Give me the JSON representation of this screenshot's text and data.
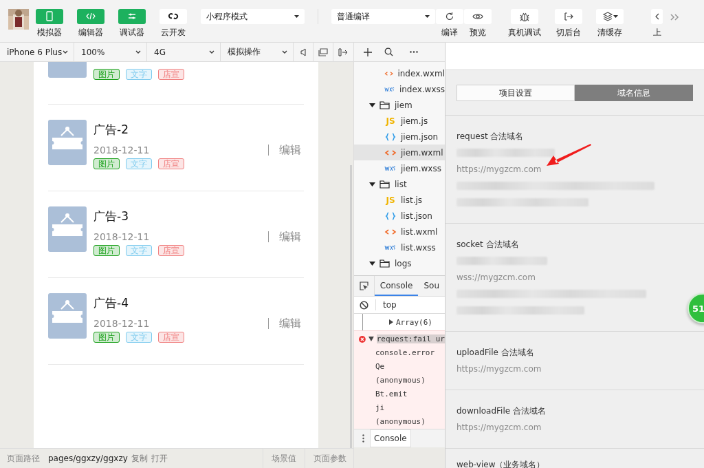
{
  "toolbar": {
    "view_toggles": [
      {
        "label": "模拟器",
        "on": true
      },
      {
        "label": "编辑器",
        "on": true
      },
      {
        "label": "调试器",
        "on": true
      },
      {
        "label": "云开发",
        "on": false
      }
    ],
    "mode_select": "小程序模式",
    "compile_select": "普通编译",
    "actions": [
      {
        "label": "编译"
      },
      {
        "label": "预览"
      },
      {
        "label": "真机调试"
      },
      {
        "label": "切后台"
      },
      {
        "label": "清缓存"
      },
      {
        "label": "上"
      }
    ]
  },
  "device_bar": {
    "device": "iPhone 6 Plus",
    "zoom": "100%",
    "network": "4G",
    "operation": "模拟操作"
  },
  "ad_list": [
    {
      "kind": "partial",
      "tags": [
        {
          "text": "图片",
          "color": "#1aa01a"
        },
        {
          "text": "文字",
          "color": "#7fcbee"
        },
        {
          "text": "店宣",
          "color": "#f07f7f"
        }
      ]
    },
    {
      "kind": "full",
      "title": "广告-2",
      "date": "2018-12-11",
      "edit": "编辑",
      "tags": [
        {
          "text": "图片",
          "color": "#1aa01a"
        },
        {
          "text": "文字",
          "color": "#7fcbee"
        },
        {
          "text": "店宣",
          "color": "#f07f7f"
        }
      ]
    },
    {
      "kind": "full",
      "title": "广告-3",
      "date": "2018-12-11",
      "edit": "编辑",
      "tags": [
        {
          "text": "图片",
          "color": "#1aa01a"
        },
        {
          "text": "文字",
          "color": "#7fcbee"
        },
        {
          "text": "店宣",
          "color": "#f07f7f"
        }
      ]
    },
    {
      "kind": "full",
      "title": "广告-4",
      "date": "2018-12-11",
      "edit": "编辑",
      "tags": [
        {
          "text": "图片",
          "color": "#1aa01a"
        },
        {
          "text": "文字",
          "color": "#7fcbee"
        },
        {
          "text": "店宣",
          "color": "#f07f7f"
        }
      ]
    }
  ],
  "status_bar": {
    "path_label": "页面路径",
    "path": "pages/ggxzy/ggxzy",
    "copy": "复制",
    "open": "打开",
    "scene": "场景值",
    "params": "页面参数"
  },
  "file_tree": {
    "partial_children": [
      {
        "name": "index.wxml",
        "kind": "wxml",
        "selected": false
      },
      {
        "name": "index.wxss",
        "kind": "wxss",
        "selected": false
      }
    ],
    "items": [
      {
        "name": "jiem",
        "kind": "folder",
        "expanded": true,
        "children": [
          {
            "name": "jiem.js",
            "kind": "js",
            "icon_text": "JS",
            "selected": false
          },
          {
            "name": "jiem.json",
            "kind": "json",
            "selected": false
          },
          {
            "name": "jiem.wxml",
            "kind": "wxml",
            "selected": true
          },
          {
            "name": "jiem.wxss",
            "kind": "wxss",
            "selected": false
          }
        ]
      },
      {
        "name": "list",
        "kind": "folder",
        "expanded": true,
        "children": [
          {
            "name": "list.js",
            "kind": "js",
            "icon_text": "JS",
            "selected": false
          },
          {
            "name": "list.json",
            "kind": "json",
            "selected": false
          },
          {
            "name": "list.wxml",
            "kind": "wxml",
            "selected": false
          },
          {
            "name": "list.wxss",
            "kind": "wxss",
            "selected": false
          }
        ]
      },
      {
        "name": "logs",
        "kind": "folder",
        "expanded": true
      }
    ]
  },
  "console": {
    "tabs": [
      {
        "label": "Console",
        "selected": true
      },
      {
        "label": "Sou",
        "selected": false
      }
    ],
    "context": "top",
    "array_line": "Array(6)",
    "error": {
      "message": "request:fail ur",
      "stack": [
        "console.error",
        "Qe",
        "(anonymous)",
        "Bt.emit",
        "ji",
        "(anonymous)"
      ]
    },
    "drawer_tab": "Console"
  },
  "settings_panel": {
    "tabs": [
      {
        "label": "项目设置",
        "selected": false
      },
      {
        "label": "域名信息",
        "selected": true
      }
    ],
    "sections": [
      {
        "title": "request 合法域名",
        "entries": [
          {
            "kind": "redacted"
          },
          {
            "kind": "url",
            "text": "https://mygzcm.com"
          },
          {
            "kind": "redacted"
          },
          {
            "kind": "redacted"
          }
        ]
      },
      {
        "title": "socket 合法域名",
        "entries": [
          {
            "kind": "redacted"
          },
          {
            "kind": "url",
            "text": "wss://mygzcm.com"
          },
          {
            "kind": "redacted"
          },
          {
            "kind": "redacted"
          }
        ]
      },
      {
        "title": "uploadFile 合法域名",
        "entries": [
          {
            "kind": "url",
            "text": "https://mygzcm.com"
          }
        ]
      },
      {
        "title": "downloadFile 合法域名",
        "entries": [
          {
            "kind": "url",
            "text": "https://mygzcm.com"
          }
        ]
      },
      {
        "title": "web-view（业务域名）"
      }
    ],
    "badge": "51"
  }
}
